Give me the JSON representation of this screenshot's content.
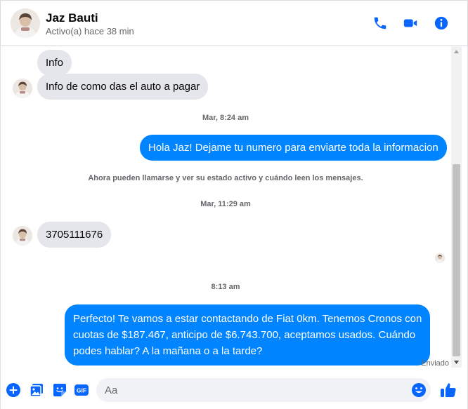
{
  "header": {
    "name": "Jaz Bauti",
    "status": "Activo(a) hace 38 min"
  },
  "messages": {
    "m1": "Info",
    "m2": "Info de como das el auto a pagar",
    "t1": "Mar, 8:24 am",
    "m3": "Hola Jaz! Dejame tu numero para enviarte toda la informacion",
    "system": "Ahora pueden llamarse y ver su estado activo y cuándo leen los mensajes.",
    "t2": "Mar, 11:29 am",
    "m4": "3705111676",
    "t3": "8:13 am",
    "m5_lines": [
      "Perfecto! Te vamos a estar contactando de Fiat 0km. Tenemos Cronos con",
      "cuotas de $187.467, anticipo de $6.743.700, aceptamos usados. Cuándo",
      "podes hablar? A la mañana o a la tarde?"
    ],
    "sent": "Enviado"
  },
  "composer": {
    "placeholder": "Aa",
    "gif_label": "GIF"
  },
  "colors": {
    "accent": "#0084ff",
    "incoming_bubble": "#e4e6eb",
    "icon_blue": "#0866ff"
  }
}
